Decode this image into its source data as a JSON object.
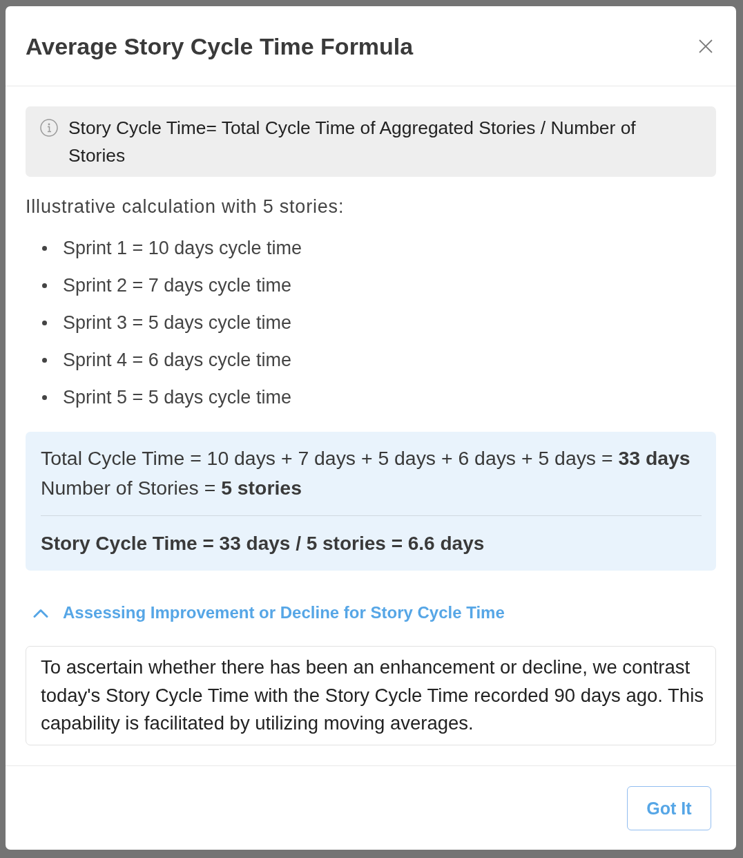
{
  "dialog": {
    "title": "Average Story Cycle Time Formula"
  },
  "info_note": {
    "text": "Story Cycle Time= Total Cycle Time of Aggregated Stories / Number of Stories"
  },
  "intro": "Illustrative calculation with 5 stories:",
  "examples": [
    "Sprint 1 = 10 days cycle time",
    "Sprint 2 = 7 days cycle time",
    "Sprint 3 = 5 days cycle time",
    "Sprint 4 = 6 days cycle time",
    "Sprint 5 = 5 days cycle time"
  ],
  "calculation": {
    "lines": [
      "Total Cycle Time = 10 days + 7 days + 5 days + 6 days + 5 days = **33 days**",
      "Number of Stories = **5 stories**"
    ],
    "result": "Story Cycle Time = 33 days / 5 stories = 6.6 days"
  },
  "section": {
    "title": "Assessing Improvement or Decline for Story Cycle Time",
    "expanded": true,
    "text": "To ascertain whether there has been an enhancement or decline, we contrast today's Story Cycle Time with the Story Cycle Time recorded 90 days ago. This capability is facilitated by utilizing moving averages."
  },
  "footer": {
    "buttons": [
      "Got It"
    ]
  }
}
